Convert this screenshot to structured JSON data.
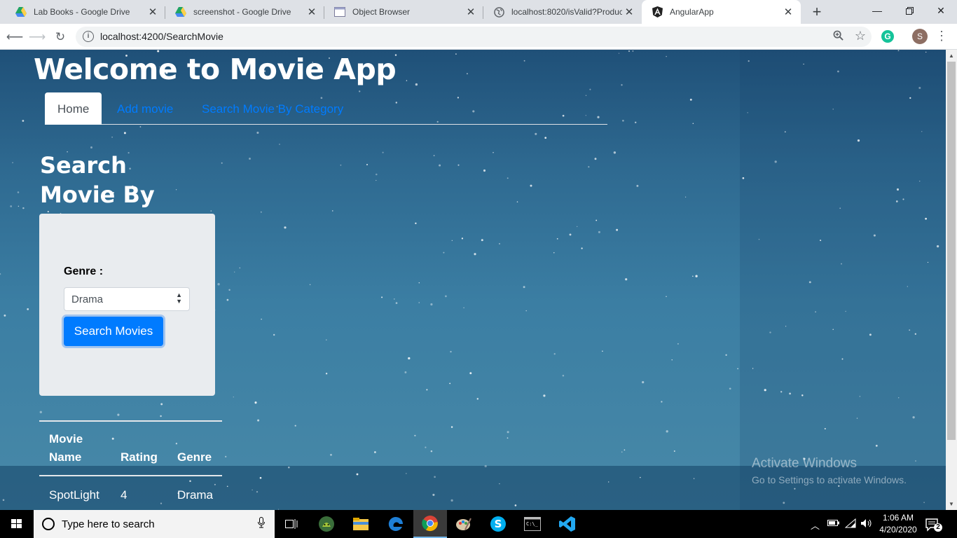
{
  "browser": {
    "tabs": [
      {
        "title": "Lab Books - Google Drive",
        "icon": "google-drive-icon"
      },
      {
        "title": "screenshot - Google Drive",
        "icon": "google-drive-icon"
      },
      {
        "title": "Object Browser",
        "icon": "window-icon"
      },
      {
        "title": "localhost:8020/isValid?Product",
        "icon": "globe-icon"
      },
      {
        "title": "AngularApp",
        "icon": "angular-icon"
      }
    ],
    "url": "localhost:4200/SearchMovie",
    "profile_initial": "S",
    "grammarly": "G"
  },
  "app": {
    "title": "Welcome to Movie App",
    "nav": [
      {
        "label": "Home"
      },
      {
        "label": "Add movie"
      },
      {
        "label": "Search Movie By Category"
      }
    ]
  },
  "search": {
    "heading": "Search Movie By Genre",
    "genre_label": "Genre :",
    "genre_selected": "Drama",
    "button_label": "Search Movies"
  },
  "results": {
    "headers": [
      "Movie Name",
      "Rating",
      "Genre"
    ],
    "rows": [
      {
        "name": "SpotLight",
        "rating": "4",
        "genre": "Drama"
      }
    ]
  },
  "watermark": {
    "line1": "Activate Windows",
    "line2": "Go to Settings to activate Windows."
  },
  "taskbar": {
    "search_placeholder": "Type here to search",
    "time": "1:06 AM",
    "date": "4/20/2020",
    "notification_count": "2"
  },
  "colors": {
    "accent": "#007bff",
    "background_top": "#1f5078",
    "background_bottom": "#4889a8",
    "card": "#e9ecef"
  }
}
